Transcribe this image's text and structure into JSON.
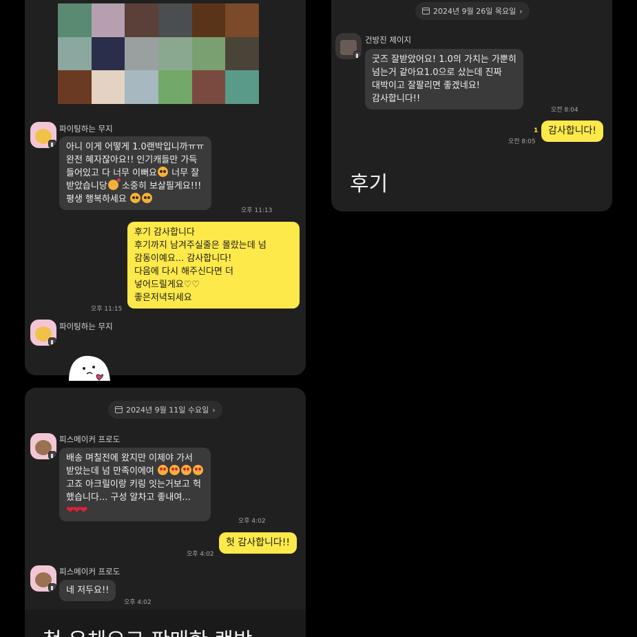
{
  "left_top": {
    "msg1": {
      "sender": "파이팅하는 무지",
      "lines": [
        "아니 이게 어떻게 1.0랜박입니까ㅠㅠ",
        "완전 혜자잖아요!!  인기캐들만 가득",
        "들어있고 다 너무 이뻐요",
        "받았습니당",
        "평생 행복하세요"
      ],
      "line3_suffix": " 너무 잘",
      "line4_suffix": " 소중히 보살필게요!!!",
      "time": "오후 11:13"
    },
    "reply1": {
      "lines": [
        "후기 감사합니다",
        "후기까지 남겨주실줄은 몰랐는데 넘",
        "감동이예요... 감사합니다!",
        "다음에 다시 해주신다면 더",
        "넣어드릴게요♡♡",
        "좋은저녁되세요"
      ],
      "time": "오후 11:15"
    },
    "msg2": {
      "sender": "파이팅하는 무지"
    }
  },
  "right_top": {
    "date": "2024년 9월 26일 목요일",
    "msg1": {
      "sender": "건방진 제이지",
      "lines": [
        "굿즈 잘받았어요! 1.0의 가치는 가뿐히",
        "넘는거 같아요1.0으로 샀는데 진짜",
        "대박이고 잘팔리면 좋겠네요!",
        "감사합니다!!"
      ],
      "time": "오전 8:04"
    },
    "reply1": {
      "text": "감사합니다!",
      "time": "오전 8:05",
      "unread": "1"
    },
    "caption": "후기"
  },
  "left_bottom": {
    "date": "2024년 9월 11일 수요일",
    "msg1": {
      "sender": "피스메이커 프로도",
      "lines": [
        "배송 며칠전에 왔지만 이제야 가서",
        "받았는데 넘 만족이에여",
        "고죠 아크릴이랑 키링 잇는거보고 헉",
        "했습니다... 구성 알차고 좋내여..."
      ],
      "time": "오후 4:02"
    },
    "reply1": {
      "text": "헛 감사합니다!!",
      "time": "오후 4:02"
    },
    "msg2": {
      "sender": "피스메이커 프로도",
      "text": "네 저두요!!",
      "time": "오후 4:02"
    },
    "caption": "첫 우체오크 판매한 랜박"
  },
  "colors": {
    "yellow_bubble": "#fde94a",
    "grey_bubble": "#3a3a3a",
    "card_bg": "#202020",
    "page_bg": "#000000"
  },
  "mosaic_colors": [
    "#5a8a72",
    "#b6a0b0",
    "#5a4038",
    "#4a4e50",
    "#5a3418",
    "#7a4a2a",
    "#8aa8a0",
    "#2a2e4a",
    "#9aa0a0",
    "#8aa890",
    "#7aa072",
    "#4a4438",
    "#6a3a22",
    "#e4d2c2",
    "#a8b8c0",
    "#72a868",
    "#7a4a40",
    "#5a9a88"
  ]
}
